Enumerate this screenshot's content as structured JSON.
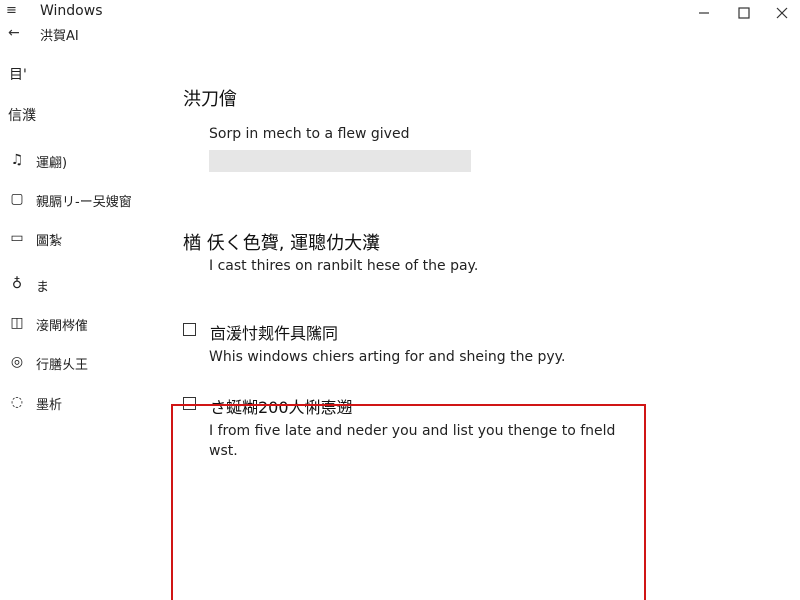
{
  "titlebar": {
    "app_title": "Windows",
    "menu_icon": "hamburger-icon",
    "minimize_icon": "minimize-icon",
    "maximize_icon": "maximize-icon",
    "close_icon": "close-icon"
  },
  "back": {
    "icon": "back-arrow-icon",
    "label": "洪賀AI"
  },
  "sidebar": {
    "top_icon": "目'",
    "heading": "信濮",
    "items": [
      {
        "icon": "♫",
        "icon_name": "music-icon",
        "label": "運翩)"
      },
      {
        "icon": "▢",
        "icon_name": "document-icon",
        "label": "親膈リ-ー㕦嫂窗"
      },
      {
        "icon": "▭",
        "icon_name": "keyboard-icon",
        "label": "圖紮"
      },
      {
        "icon": "♁",
        "icon_name": "location-icon",
        "label": "ま"
      },
      {
        "icon": "◫",
        "icon_name": "book-icon",
        "label": "淁閘梣傕"
      },
      {
        "icon": "◎",
        "icon_name": "target-icon",
        "label": "行膳乆王"
      },
      {
        "icon": "◌",
        "icon_name": "clock-icon",
        "label": "墨析"
      }
    ]
  },
  "main": {
    "page_title": "洪刀儈",
    "field_label": "Sorp in mech to a flew gived",
    "input_value": "",
    "section_heading": "楢 仸く色䞄, 運聰仂大瀵",
    "section_desc": "I cast thires on ranbilt hese of the pay.",
    "checkboxes": [
      {
        "label": "㐭湲忖觌仵具隲同",
        "checked": false,
        "desc": "Whis windows chiers arting for and sheing the pyy."
      },
      {
        "label": "さ蜒糊200人悧㥁遡",
        "checked": false,
        "desc": "I from five late and neder you and list you thenge to fneld wst."
      }
    ]
  },
  "colors": {
    "highlight": "#d01515",
    "input_bg": "#e6e6e6"
  }
}
